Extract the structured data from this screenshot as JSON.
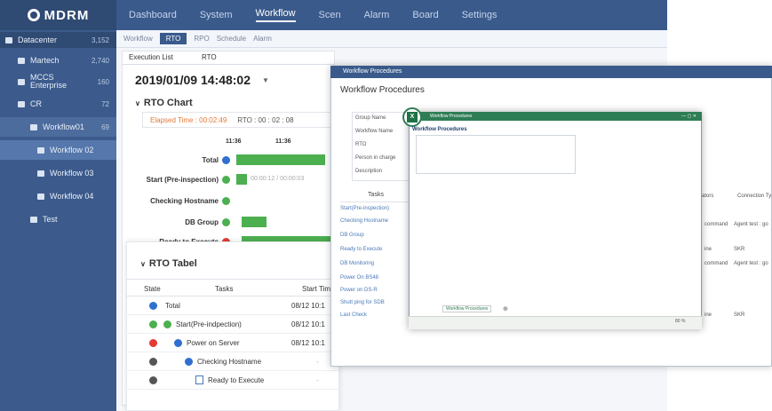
{
  "app": {
    "logo_text": "MDRM"
  },
  "topnav": {
    "items": [
      "Dashboard",
      "System",
      "Workflow",
      "Scen",
      "Alarm",
      "Board",
      "Settings"
    ],
    "active": "Workflow"
  },
  "sidebar": {
    "datacenter": {
      "label": "Datacenter",
      "count": "3,152"
    },
    "items": [
      {
        "label": "Martech",
        "count": "2,740"
      },
      {
        "label": "MCCS Enterprise",
        "count": "160"
      },
      {
        "label": "CR",
        "count": "72"
      },
      {
        "label": "Workflow01",
        "count": "69"
      },
      {
        "label": "Workflow 02",
        "count": ""
      },
      {
        "label": "Workflow 03",
        "count": ""
      },
      {
        "label": "Workflow 04",
        "count": ""
      },
      {
        "label": "Test",
        "count": ""
      }
    ]
  },
  "subtabs": {
    "items": [
      "Workflow",
      "RTO",
      "RPO",
      "Schedule",
      "Alarm"
    ],
    "active": "RTO"
  },
  "execution": {
    "tabs": [
      "Execution List",
      "RTO"
    ],
    "datetime": "2019/01/09 14:48:02",
    "rto_chart_title": "RTO Chart",
    "elapsed": "Elapsed Time : 00:02:49",
    "rto": "RTO : 00 : 02 : 08",
    "time_labels": [
      "11:36",
      "11:36"
    ],
    "steps": [
      {
        "label": "Total",
        "status": "running"
      },
      {
        "label": "Start (Pre-inspection)",
        "status": "success",
        "time_text": "00:00:12 / 00:00:03"
      },
      {
        "label": "Checking Hostname",
        "status": "success"
      },
      {
        "label": "DB Group",
        "status": "success"
      },
      {
        "label": "Ready to Execute",
        "status": "error"
      }
    ]
  },
  "rto_tabel": {
    "title": "RTO Tabel",
    "columns": [
      "State",
      "Tasks",
      "Start Tim"
    ],
    "rows": [
      {
        "task": "Total",
        "start": "08/12 10:1",
        "status": "running"
      },
      {
        "task": "Start(Pre-indpection)",
        "start": "08/12 10:1",
        "status": "success"
      },
      {
        "task": "Power on Server",
        "start": "08/12 10:1",
        "status": "error"
      },
      {
        "task": "Checking Hostname",
        "start": "-",
        "status": "pending"
      },
      {
        "task": "Ready to Execute",
        "start": "-",
        "status": "pending"
      }
    ]
  },
  "workflow_procedures": {
    "window_title": "Workflow Procedures",
    "heading": "Workflow Procedures",
    "fields": [
      "Group Name",
      "Workflow Name",
      "RTO",
      "Person in charge",
      "Description"
    ],
    "tasks_header": "Tasks",
    "tasks": [
      "Start(Pre-inspection)",
      "Checking Hostname",
      "DB Group",
      "Ready to Execute",
      "DB Monitoring",
      "Power On BS48",
      "Power on DS-R",
      "Shutt ping for SDB",
      "Last Check"
    ],
    "right_headers": [
      "ators",
      "Connection Ty"
    ],
    "right_rows": [
      {
        "a": "command",
        "b": "Agent test : go"
      },
      {
        "a": "ine",
        "b": "SKR"
      },
      {
        "a": "command",
        "b": "Agent test : go"
      },
      {
        "a": "ine",
        "b": "SKR"
      }
    ]
  },
  "excel": {
    "title": "Workflow Procedures",
    "heading": "Workflow Procedures",
    "sheet_tab": "Workflow Procedures",
    "zoom": "80 %",
    "brand_color": "#2e7d55"
  },
  "colors": {
    "nav": "#3a5a8c",
    "success": "#4caf50",
    "error": "#e53935",
    "running": "#2f6fcf",
    "pending": "#555555"
  }
}
